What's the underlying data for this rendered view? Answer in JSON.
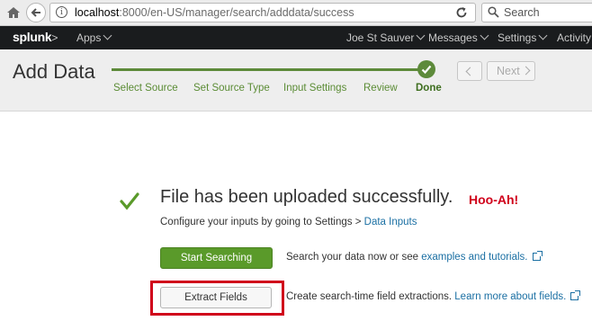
{
  "browser": {
    "url_host": "localhost",
    "url_rest": ":8000/en-US/manager/search/adddata/success",
    "search_placeholder": "Search"
  },
  "nav": {
    "logo": "splunk",
    "logo_chevron": ">",
    "apps": "Apps",
    "user": "Joe St Sauver",
    "messages": "Messages",
    "settings": "Settings",
    "activity": "Activity"
  },
  "wizard": {
    "title": "Add Data",
    "steps": [
      "Select Source",
      "Set Source Type",
      "Input Settings",
      "Review",
      "Done"
    ],
    "prev_label": "",
    "next_label": "Next"
  },
  "success": {
    "title": "File has been uploaded successfully.",
    "annotation": "Hoo-Ah!",
    "configure_text": "Configure your inputs by going to Settings > ",
    "configure_link": "Data Inputs",
    "start_button": "Start Searching",
    "search_text": "Search your data now or see ",
    "search_link": "examples and tutorials.",
    "extract_button": "Extract Fields",
    "extract_text": "Create search-time field extractions. ",
    "extract_link": "Learn more about fields."
  },
  "colors": {
    "accent_green": "#5a9a2a",
    "annotation_red": "#d0021b",
    "link_blue": "#1a6fa3"
  }
}
